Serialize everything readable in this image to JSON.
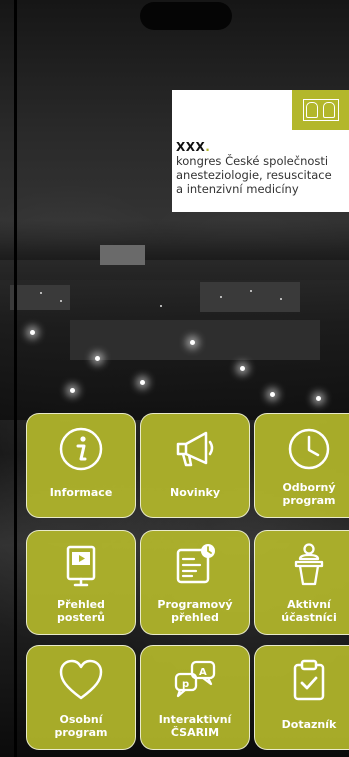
{
  "logo": {
    "title_prefix": "XXX",
    "title_dot": ".",
    "lines": [
      "kongres České společnosti",
      "anesteziologie, resuscitace",
      "a  intenzivní medicíny"
    ]
  },
  "tiles": [
    {
      "label": "Informace",
      "icon": "info-icon"
    },
    {
      "label": "Novinky",
      "icon": "megaphone-icon"
    },
    {
      "label": "Odborný\nprogram",
      "icon": "clock-icon"
    },
    {
      "label": "Přehled\nposterů",
      "icon": "poster-icon"
    },
    {
      "label": "Programový\npřehled",
      "icon": "program-overview-icon"
    },
    {
      "label": "Aktivní\núčastníci",
      "icon": "speaker-podium-icon"
    },
    {
      "label": "Osobní\nprogram",
      "icon": "heart-icon"
    },
    {
      "label": "Interaktivní\nČSARIM",
      "icon": "chat-bubbles-icon"
    },
    {
      "label": "Dotazník",
      "icon": "clipboard-check-icon"
    }
  ],
  "colors": {
    "accent": "#b3b72b",
    "tile_border": "#ffffff",
    "text": "#ffffff"
  }
}
